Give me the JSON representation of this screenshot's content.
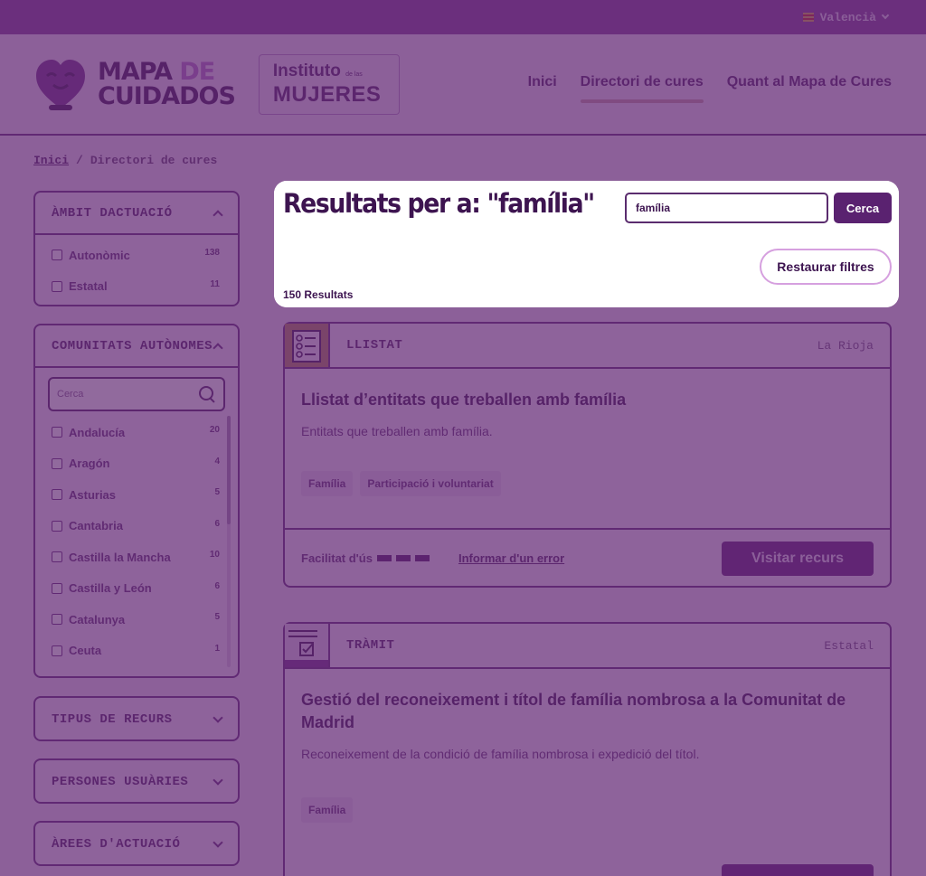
{
  "language": {
    "label": "Valencià"
  },
  "logo": {
    "line1": "MAPA",
    "de": "DE",
    "line2": "CUIDADOS"
  },
  "institute": {
    "line1": "Instituto",
    "small": "de las",
    "line2": "MUJERES"
  },
  "nav": {
    "items": [
      "Inici",
      "Directori de cures",
      "Quant al Mapa de Cures"
    ],
    "active": "Directori de cures"
  },
  "breadcrumb": {
    "home": "Inici",
    "sep": "/",
    "current": "Directori de cures"
  },
  "filters": {
    "ambit": {
      "title": "ÀMBIT DACTUACIÓ",
      "options": [
        {
          "label": "Autonòmic",
          "count": "138"
        },
        {
          "label": "Estatal",
          "count": "11"
        }
      ]
    },
    "comunitats": {
      "title": "COMUNITATS AUTÒNOMES",
      "search_placeholder": "Cerca",
      "options": [
        {
          "label": "Andalucía",
          "count": "20"
        },
        {
          "label": "Aragón",
          "count": "4"
        },
        {
          "label": "Asturias",
          "count": "5"
        },
        {
          "label": "Cantabria",
          "count": "6"
        },
        {
          "label": "Castilla la Mancha",
          "count": "10"
        },
        {
          "label": "Castilla y León",
          "count": "6"
        },
        {
          "label": "Catalunya",
          "count": "5"
        },
        {
          "label": "Ceuta",
          "count": "1"
        }
      ]
    },
    "tipus": {
      "title": "TIPUS DE RECURS"
    },
    "persones": {
      "title": "PERSONES USUÀRIES"
    },
    "arees": {
      "title": "ÀREES D'ACTUACIÓ"
    }
  },
  "results": {
    "title": "Resultats per a: \"família\"",
    "query": "família",
    "search_button": "Cerca",
    "reset_button": "Restaurar filtres",
    "count": "150 Resultats"
  },
  "cards": [
    {
      "type": "LLISTAT",
      "region": "La Rioja",
      "title": "Llistat d’entitats que treballen amb família",
      "description": "Entitats que treballen amb família.",
      "tags": [
        "Família",
        "Participació i voluntariat"
      ],
      "ease_label": "Facilitat d'ús",
      "ease_level": 3,
      "report_link": "Informar d'un error",
      "visit_button": "Visitar recurs"
    },
    {
      "type": "TRÀMIT",
      "region": "Estatal",
      "title": "Gestió del reconeixement i títol de família nombrosa a la Comunitat de Madrid",
      "description": "Reconeixement de la condició de família nombrosa i expedició del títol.",
      "tags": [
        "Família"
      ]
    }
  ],
  "colors": {
    "primary": "#5a2270",
    "overlay": "#5d236e",
    "accent": "#b676c9"
  }
}
